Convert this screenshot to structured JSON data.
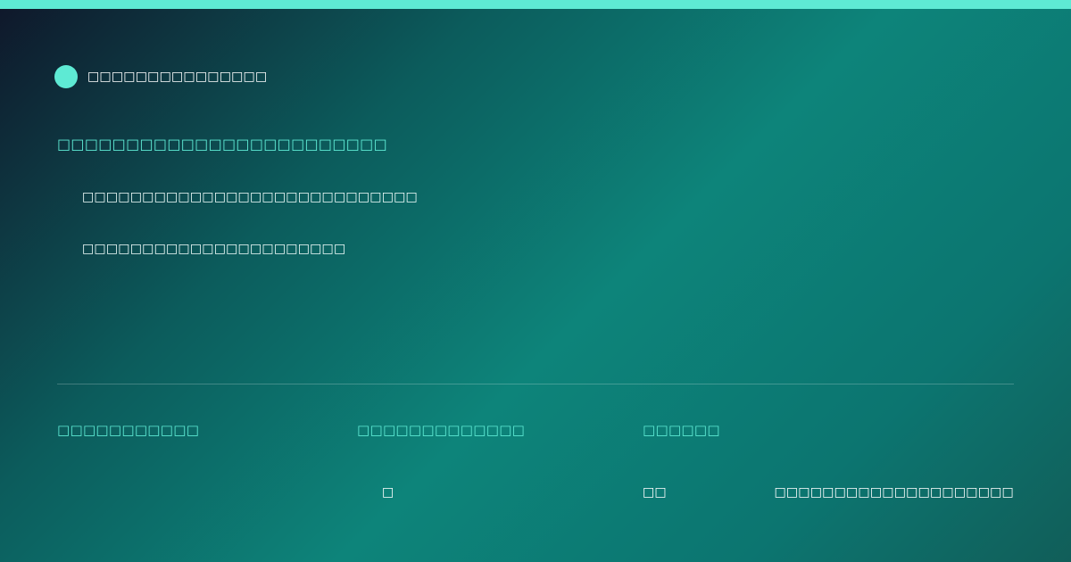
{
  "colors": {
    "accent": "#5eead4",
    "text": "#ffffff"
  },
  "brand": {
    "logo_icon": "circle-logo-icon",
    "name": "□□□□□□□□□□□□□□□"
  },
  "headline": "□□□□□□□□□□□□□□□□□□□□□□□□",
  "lines": [
    "□□□□□□□□□□□□□□□□□□□□□□□□□□□□",
    "□□□□□□□□□□□□□□□□□□□□□□"
  ],
  "stats": {
    "labels": [
      "□□□□□□□□□□□",
      "□□□□□□□□□□□□□",
      "□□□□□□"
    ],
    "values": [
      "□",
      "□□",
      "□□□□□□□□□□□□□□□□□□□□"
    ]
  }
}
